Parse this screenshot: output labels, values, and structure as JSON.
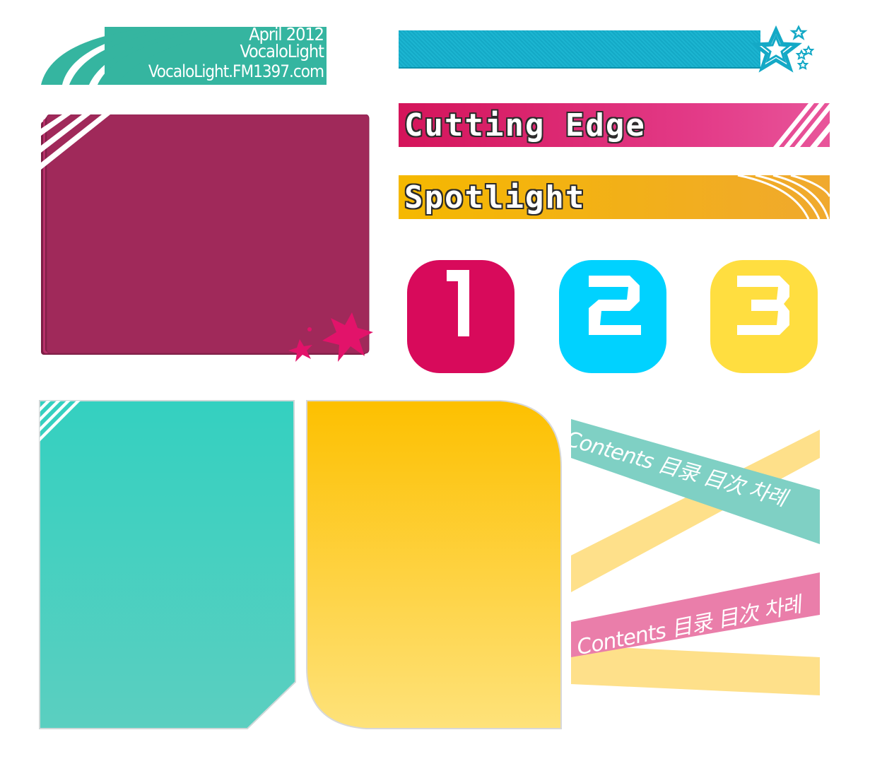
{
  "logo": {
    "line1": "April 2012",
    "line2": "VocaloLight",
    "line3": "VocaloLight.FM1397.com",
    "color": "#35b5a0"
  },
  "banners": {
    "cutting_edge": "Cutting Edge",
    "spotlight": "Spotlight"
  },
  "numbers": [
    "1",
    "2",
    "3"
  ],
  "ribbons": {
    "top": "Contents 目录 目次 차례",
    "bottom": "Contents 目录 目次 차례"
  },
  "colors": {
    "magenta": "#9e2a5a",
    "teal": "#3ccfbf",
    "yellow": "#fdc300",
    "cyan": "#14a9c6",
    "pink": "#d4145a"
  },
  "icons": [
    "star-icon",
    "burst-icon"
  ]
}
